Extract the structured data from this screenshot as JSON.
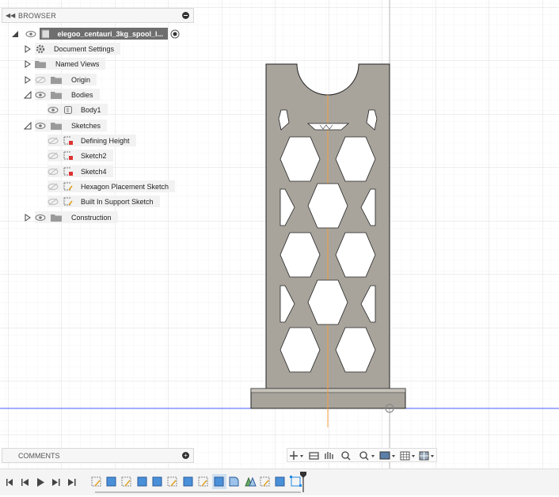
{
  "browser": {
    "title": "BROWSER",
    "document_name": "elegoo_centauri_3kg_spool_l...",
    "items": [
      {
        "label": "Document Settings"
      },
      {
        "label": "Named Views"
      },
      {
        "label": "Origin"
      },
      {
        "label": "Bodies"
      },
      {
        "label": "Body1"
      },
      {
        "label": "Sketches"
      },
      {
        "label": "Defining Height"
      },
      {
        "label": "Sketch2"
      },
      {
        "label": "Sketch4"
      },
      {
        "label": "Hexagon Placement Sketch"
      },
      {
        "label": "Built In Support Sketch"
      },
      {
        "label": "Construction"
      }
    ]
  },
  "comments": {
    "title": "COMMENTS"
  },
  "colors": {
    "grid": "#e2e2e2",
    "model_fill": "#a8a49c",
    "axis_blue": "#3a3aff",
    "axis_orange": "#f5a040",
    "accent": "#1e88e5"
  },
  "nav_toolbar": {
    "icons": [
      "orbit-icon",
      "look-at-icon",
      "pan-icon",
      "zoom-icon",
      "fit-icon",
      "display-icon",
      "grid-icon",
      "viewports-icon"
    ]
  },
  "timeline": {
    "controls": [
      "first-icon",
      "previous-icon",
      "play-icon",
      "next-icon",
      "last-icon"
    ]
  }
}
